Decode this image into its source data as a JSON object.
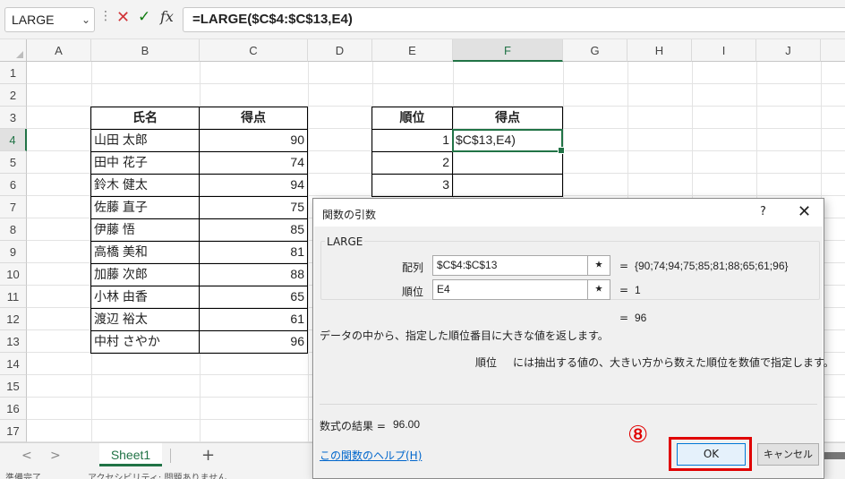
{
  "formula_bar": {
    "name_box": "LARGE",
    "formula": "=LARGE($C$4:$C$13,E4)"
  },
  "icons": {
    "name_dropdown": "chevron-down-icon",
    "cancel": "close-icon",
    "enter": "check-icon",
    "insert_function": "function-icon"
  },
  "columns": [
    "A",
    "B",
    "C",
    "D",
    "E",
    "F",
    "G",
    "H",
    "I",
    "J"
  ],
  "rows": [
    "1",
    "2",
    "3",
    "4",
    "5",
    "6",
    "7",
    "8",
    "9",
    "10",
    "11",
    "12",
    "13",
    "14",
    "15",
    "16",
    "17"
  ],
  "table1": {
    "headers": [
      "氏名",
      "得点"
    ],
    "rows": [
      {
        "name": "山田 太郎",
        "score": "90"
      },
      {
        "name": "田中 花子",
        "score": "74"
      },
      {
        "name": "鈴木 健太",
        "score": "94"
      },
      {
        "name": "佐藤 直子",
        "score": "75"
      },
      {
        "name": "伊藤 悟",
        "score": "85"
      },
      {
        "name": "高橋 美和",
        "score": "81"
      },
      {
        "name": "加藤 次郎",
        "score": "88"
      },
      {
        "name": "小林 由香",
        "score": "65"
      },
      {
        "name": "渡辺 裕太",
        "score": "61"
      },
      {
        "name": "中村 さやか",
        "score": "96"
      }
    ]
  },
  "table2": {
    "headers": [
      "順位",
      "得点"
    ],
    "ranks": [
      "1",
      "2",
      "3"
    ],
    "active_cell_text": "$C$13,E4)"
  },
  "dialog": {
    "title": "関数の引数",
    "help": "?",
    "close": "✕",
    "function_name": "LARGE",
    "arg1_label": "配列",
    "arg1_value": "$C$4:$C$13",
    "arg1_result": "{90;74;94;75;85;81;88;65;61;96}",
    "arg2_label": "順位",
    "arg2_value": "E4",
    "arg2_result": "1",
    "eq": "=",
    "result_value": "96",
    "description": "データの中から、指定した順位番目に大きな値を返します。",
    "arg_help_name": "順位",
    "arg_help_text": "には抽出する値の、大きい方から数えた順位を数値で指定します。",
    "formula_result_label": "数式の結果 =",
    "formula_result_value": "96.00",
    "help_link": "この関数のヘルプ(H)",
    "ok": "OK",
    "cancel": "キャンセル"
  },
  "annotation": {
    "marker": "⑧",
    "color": "#e00000"
  },
  "sheet_tabs": {
    "active": "Sheet1",
    "add": "+",
    "prev": "<",
    "next": ">"
  },
  "status_bar": {
    "left": "準備完了",
    "accessibility": "アクセシビリティ: 問題ありません"
  },
  "colors": {
    "excel_green": "#217346",
    "link_blue": "#0066cc",
    "ok_border": "#0078d7"
  }
}
